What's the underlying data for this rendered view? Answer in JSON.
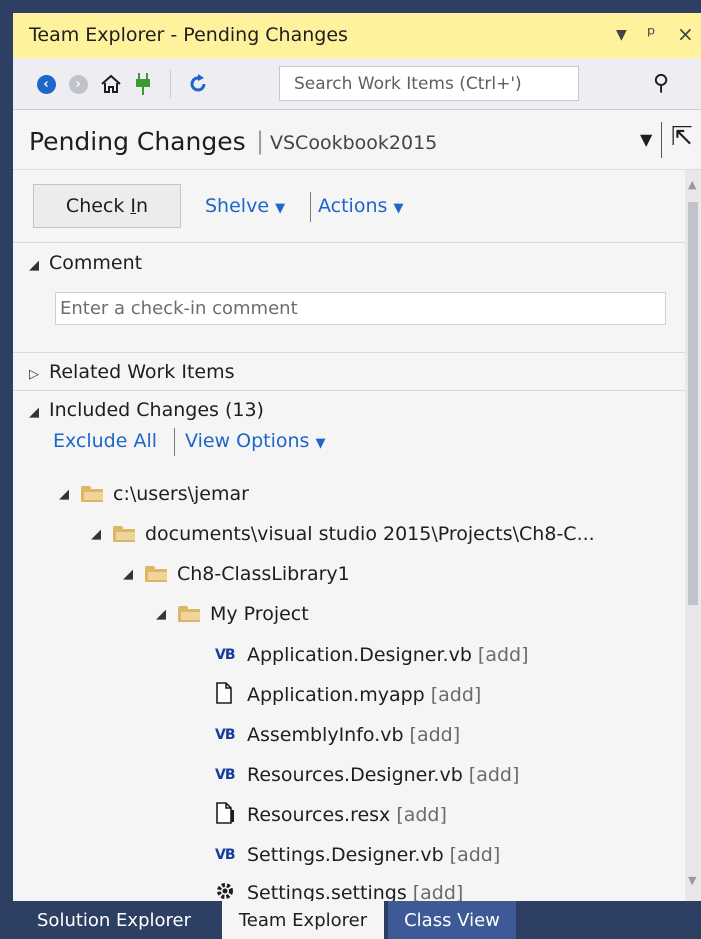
{
  "window": {
    "title": "Team Explorer - Pending Changes",
    "controls": [
      "▾",
      "ᵖ",
      "×"
    ]
  },
  "toolbar": {
    "search_placeholder": "Search Work Items (Ctrl+')"
  },
  "header": {
    "title": "Pending Changes",
    "separator": "|",
    "project": "VSCookbook2015"
  },
  "actions": {
    "check_in": "Check In",
    "shelve": "Shelve",
    "actions": "Actions"
  },
  "comment": {
    "heading": "Comment",
    "placeholder": "Enter a check-in comment"
  },
  "related": {
    "heading": "Related Work Items"
  },
  "included": {
    "heading": "Included Changes (13)",
    "exclude_all": "Exclude All",
    "view_options": "View Options"
  },
  "tree": {
    "folders": [
      "c:\\users\\jemar",
      "documents\\visual studio 2015\\Projects\\Ch8-C...",
      "Ch8-ClassLibrary1",
      "My Project"
    ],
    "files": [
      {
        "icon": "vb-file-icon",
        "name": "Application.Designer.vb",
        "tag": "[add]"
      },
      {
        "icon": "document-icon",
        "name": "Application.myapp",
        "tag": "[add]"
      },
      {
        "icon": "vb-file-icon",
        "name": "AssemblyInfo.vb",
        "tag": "[add]"
      },
      {
        "icon": "vb-file-icon",
        "name": "Resources.Designer.vb",
        "tag": "[add]"
      },
      {
        "icon": "resx-file-icon",
        "name": "Resources.resx",
        "tag": "[add]"
      },
      {
        "icon": "vb-file-icon",
        "name": "Settings.Designer.vb",
        "tag": "[add]"
      },
      {
        "icon": "settings-file-icon",
        "name": "Settings.settings",
        "tag": "[add]"
      }
    ],
    "vb_badge": "VB"
  },
  "bottom_tabs": [
    "Solution Explorer",
    "Team Explorer",
    "Class View"
  ]
}
